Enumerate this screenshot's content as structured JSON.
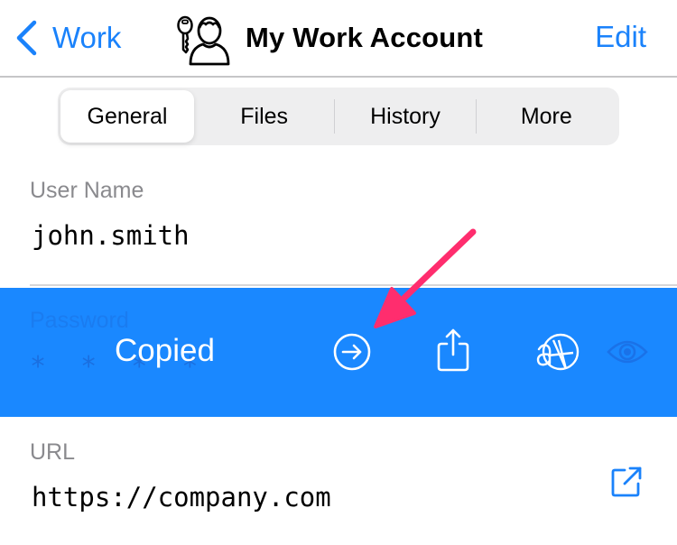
{
  "navbar": {
    "back_label": "Work",
    "title": "My Work Account",
    "title_icon": "user-key-icon",
    "edit_label": "Edit"
  },
  "tabs": [
    {
      "label": "General",
      "active": true
    },
    {
      "label": "Files",
      "active": false
    },
    {
      "label": "History",
      "active": false
    },
    {
      "label": "More",
      "active": false
    }
  ],
  "fields": {
    "username": {
      "label": "User Name",
      "value": "john.smith"
    },
    "password": {
      "label": "Password",
      "value": "* * * *"
    },
    "url": {
      "label": "URL",
      "value": "https://company.com",
      "action_icon": "open-external-icon"
    }
  },
  "copied_banner": {
    "text": "Copied",
    "actions": [
      {
        "name": "autofill",
        "icon": "arrow-circle-right-icon"
      },
      {
        "name": "share",
        "icon": "share-icon"
      },
      {
        "name": "large-type",
        "icon": "font-size-icon"
      },
      {
        "name": "reveal",
        "icon": "eye-icon"
      }
    ]
  },
  "colors": {
    "accent": "#1a82fb",
    "banner": "#1a88ff",
    "annotation_arrow": "#ff2d6e"
  }
}
